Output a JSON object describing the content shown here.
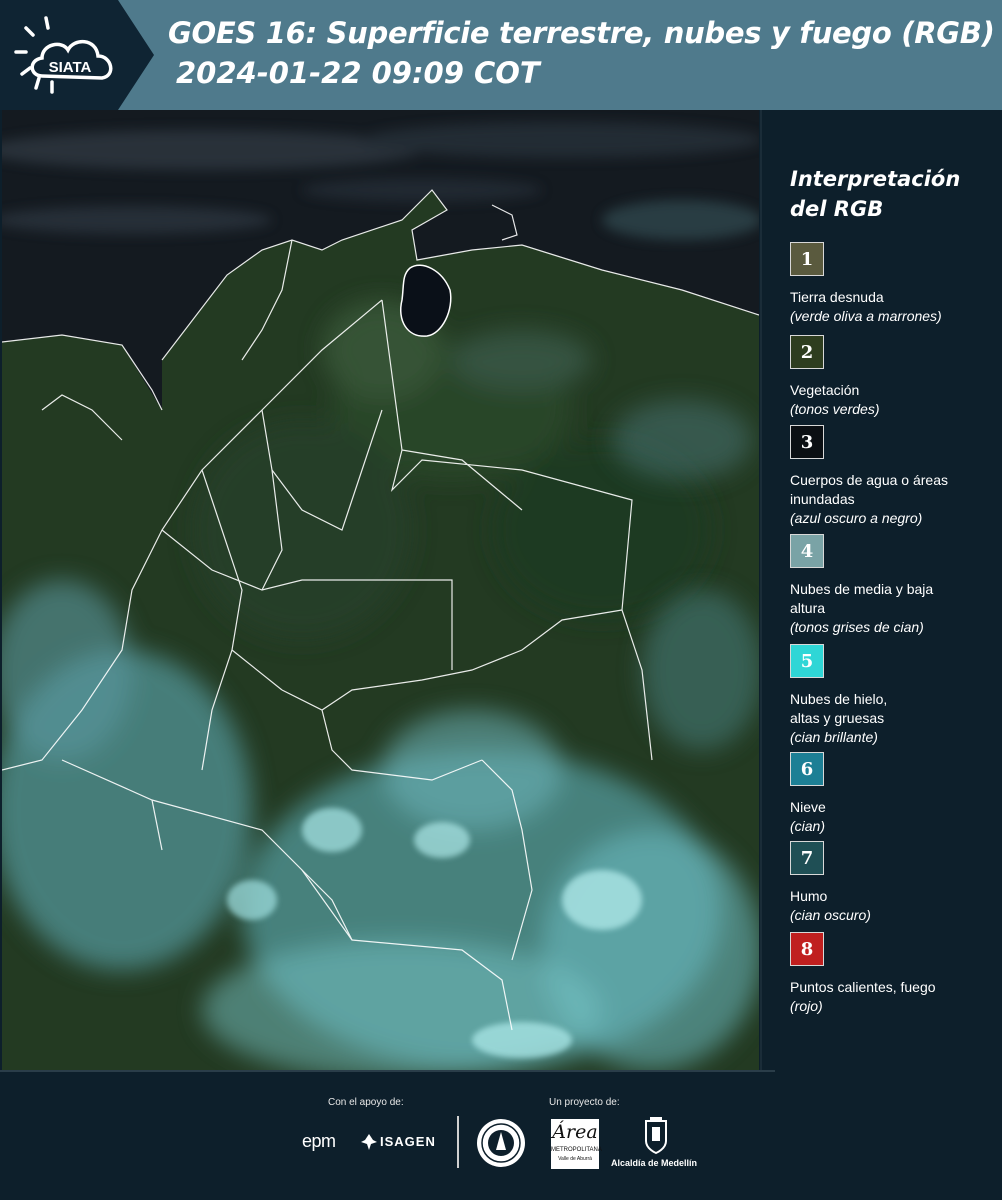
{
  "header": {
    "logo_text": "SIATA",
    "title": "GOES 16: Superficie terrestre, nubes y fuego (RGB)",
    "datetime": "2024-01-22 09:09 COT"
  },
  "legend": {
    "title_line1": "Interpretación",
    "title_line2": "del RGB",
    "items": [
      {
        "num": "1",
        "color": "#5a5a3e",
        "label": "Tierra desnuda",
        "desc": "(verde oliva a marrones)"
      },
      {
        "num": "2",
        "color": "#2e3d1f",
        "label": "Vegetación",
        "desc": "(tonos verdes)"
      },
      {
        "num": "3",
        "color": "#0b0f13",
        "label": "Cuerpos de agua o áreas inundadas",
        "desc": "(azul oscuro a negro)"
      },
      {
        "num": "4",
        "color": "#7aa3a6",
        "label": "Nubes de media y baja altura",
        "desc": "(tonos grises de cian)"
      },
      {
        "num": "5",
        "color": "#2fd6d6",
        "label": "Nubes de hielo, altas y gruesas",
        "desc": "(cian brillante)"
      },
      {
        "num": "6",
        "color": "#1d7f95",
        "label": "Nieve",
        "desc": "(cian)"
      },
      {
        "num": "7",
        "color": "#1f4f55",
        "label": "Humo",
        "desc": "(cian oscuro)"
      },
      {
        "num": "8",
        "color": "#c01f1f",
        "label": "Puntos calientes, fuego",
        "desc": "(rojo)"
      }
    ]
  },
  "footer": {
    "support_label": "Con el apoyo de:",
    "project_label": "Un proyecto de:",
    "epm": "epm",
    "isagen": "ISAGEN",
    "metropolitana_big": "Área",
    "metropolitana_small": "METROPOLITANA",
    "metropolitana_sub": "Valle de Aburrá",
    "alcaldia": "Alcaldía de Medellín"
  }
}
